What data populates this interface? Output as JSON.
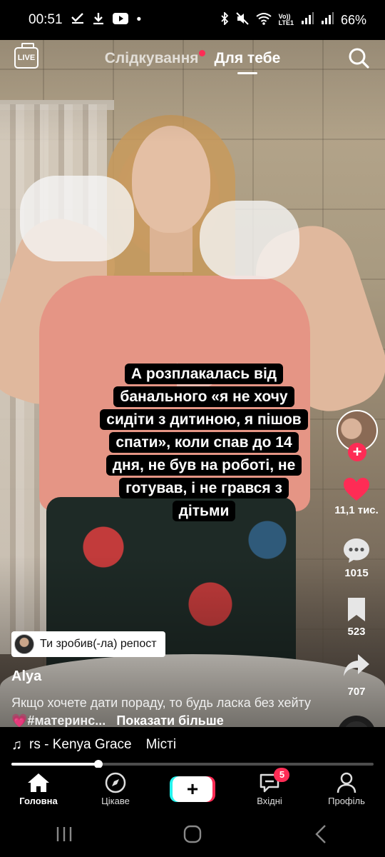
{
  "status_bar": {
    "time": "00:51",
    "battery": "66%",
    "notif_icons": [
      "check-icon",
      "download-icon",
      "youtube-icon",
      "dot"
    ],
    "system_icons": [
      "bluetooth-icon",
      "mute-icon",
      "wifi-icon",
      "volte-icon",
      "signal-icon",
      "signal-icon"
    ],
    "volte_label": "Vo))\nLTE1"
  },
  "header": {
    "live_label": "LIVE",
    "tabs": [
      {
        "label": "Слідкування",
        "has_dot": true
      },
      {
        "label": "Для тебе",
        "active": true
      }
    ]
  },
  "video": {
    "caption": "А розплакалась від банального «я не хочу сидіти з дитиною, я пішов спати», коли спав до 14 дня, не був на роботі, не готував, і не грався з дітьми"
  },
  "right_rail": {
    "likes": "11,1 тис.",
    "comments": "1015",
    "saves": "523",
    "shares": "707"
  },
  "info": {
    "repost_label": "Ти зробив(-ла) репост",
    "username": "Alya",
    "description": "Якщо хочете дати пораду, то будь ласка без хейту",
    "description_emoji": "💗",
    "hashtag": "#материнс...",
    "show_more": "Показати більше"
  },
  "music": {
    "track": "rs - Kenya Grace",
    "extra": "Місті",
    "progress": 0.24
  },
  "bottom_nav": {
    "items": [
      {
        "label": "Головна",
        "icon": "home-icon",
        "active": true
      },
      {
        "label": "Цікаве",
        "icon": "compass-icon"
      },
      {
        "label": "",
        "icon": "plus-icon"
      },
      {
        "label": "Вхідні",
        "icon": "inbox-icon",
        "badge": "5"
      },
      {
        "label": "Профіль",
        "icon": "profile-icon"
      }
    ]
  },
  "colors": {
    "accent": "#fe2c55",
    "cyan": "#25f4ee"
  }
}
